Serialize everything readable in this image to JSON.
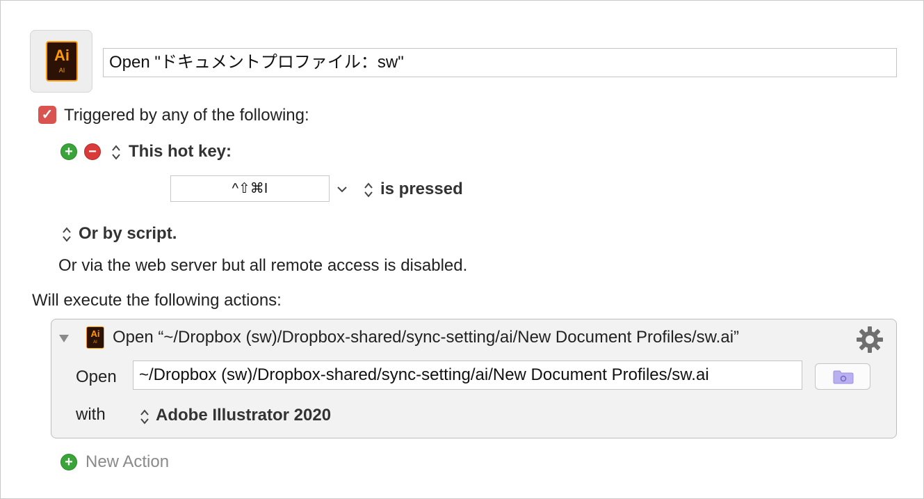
{
  "macro": {
    "name": "Open \"ドキュメントプロファイル：sw\"",
    "app_icon": "adobe-illustrator-icon",
    "app_icon_text": "Ai",
    "app_icon_subtext": "AI"
  },
  "triggers": {
    "enabled_mark": "✓",
    "header": "Triggered by any of the following:",
    "hotkey_trigger_label": "This hot key:",
    "hotkey": "^⇧⌘I",
    "hotkey_condition": "is pressed",
    "script_trigger_label": "Or by script.",
    "web_server_note": "Or via the web server but all remote access is disabled."
  },
  "actions": {
    "header": "Will execute the following actions:",
    "items": [
      {
        "title": "Open “~/Dropbox (sw)/Dropbox-shared/sync-setting/ai/New Document Profiles/sw.ai”",
        "open_label": "Open",
        "path": "~/Dropbox (sw)/Dropbox-shared/sync-setting/ai/New Document Profiles/sw.ai",
        "with_label": "with",
        "application": "Adobe Illustrator 2020"
      }
    ],
    "new_action_label": "New Action"
  },
  "colors": {
    "checkbox": "#d9534f",
    "add": "#3aa33a",
    "remove": "#d93a3a",
    "ai_orange": "#ff9a00",
    "ai_bg": "#2b1204"
  }
}
